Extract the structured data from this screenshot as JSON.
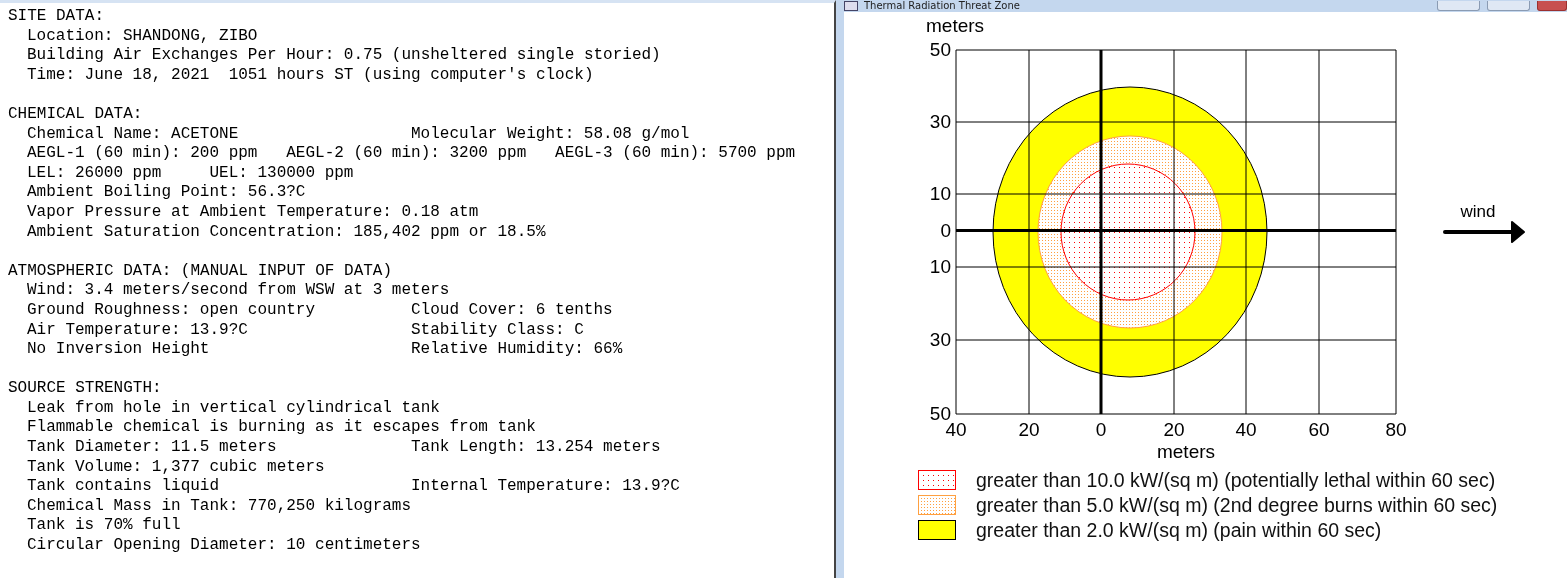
{
  "report": {
    "sections": [
      {
        "heading": "SITE DATA:",
        "lines": [
          {
            "text": "Location: SHANDONG, ZIBO"
          },
          {
            "text": "Building Air Exchanges Per Hour: 0.75 (unsheltered single storied)"
          },
          {
            "text": "Time: June 18, 2021  1051 hours ST (using computer's clock)"
          }
        ]
      },
      {
        "heading": "CHEMICAL DATA:",
        "lines": [
          {
            "text": "Chemical Name: ACETONE",
            "right": "Molecular Weight: 58.08 g/mol"
          },
          {
            "text": "AEGL-1 (60 min): 200 ppm   AEGL-2 (60 min): 3200 ppm   AEGL-3 (60 min): 5700 ppm"
          },
          {
            "text": "LEL: 26000 ppm     UEL: 130000 ppm"
          },
          {
            "text": "Ambient Boiling Point: 56.3?C"
          },
          {
            "text": "Vapor Pressure at Ambient Temperature: 0.18 atm"
          },
          {
            "text": "Ambient Saturation Concentration: 185,402 ppm or 18.5%"
          }
        ]
      },
      {
        "heading": "ATMOSPHERIC DATA: (MANUAL INPUT OF DATA)",
        "lines": [
          {
            "text": "Wind: 3.4 meters/second from WSW at 3 meters"
          },
          {
            "text": "Ground Roughness: open country",
            "right": "Cloud Cover: 6 tenths"
          },
          {
            "text": "Air Temperature: 13.9?C",
            "right": "Stability Class: C"
          },
          {
            "text": "No Inversion Height",
            "right": "Relative Humidity: 66%"
          }
        ]
      },
      {
        "heading": "SOURCE STRENGTH:",
        "lines": [
          {
            "text": "Leak from hole in vertical cylindrical tank"
          },
          {
            "text": "Flammable chemical is burning as it escapes from tank"
          },
          {
            "text": "Tank Diameter: 11.5 meters",
            "right": "Tank Length: 13.254 meters"
          },
          {
            "text": "Tank Volume: 1,377 cubic meters"
          },
          {
            "text": "Tank contains liquid",
            "right": "Internal Temperature: 13.9?C"
          },
          {
            "text": "Chemical Mass in Tank: 770,250 kilograms"
          },
          {
            "text": "Tank is 70% full"
          },
          {
            "text": "Circular Opening Diameter: 10 centimeters"
          }
        ]
      }
    ]
  },
  "threat_zone_window": {
    "title": "Thermal Radiation Threat Zone",
    "plot": {
      "y_label": "meters",
      "y_ticks": [
        "50",
        "30",
        "10",
        "0",
        "10",
        "30",
        "50"
      ],
      "x_ticks": [
        "40",
        "20",
        "0",
        "20",
        "40",
        "60",
        "80"
      ],
      "x_label": "meters",
      "wind_label": "wind"
    },
    "legend": [
      {
        "text": "greater than 10.0 kW/(sq m) (potentially lethal within 60 sec)",
        "color": "#ff0000",
        "kind": "dotted"
      },
      {
        "text": "greater than 5.0 kW/(sq m) (2nd degree burns within 60 sec)",
        "color": "#ffa040",
        "kind": "dotted"
      },
      {
        "text": "greater than 2.0 kW/(sq m) (pain within 60 sec)",
        "color": "#ffff00",
        "kind": "solid"
      }
    ]
  }
}
